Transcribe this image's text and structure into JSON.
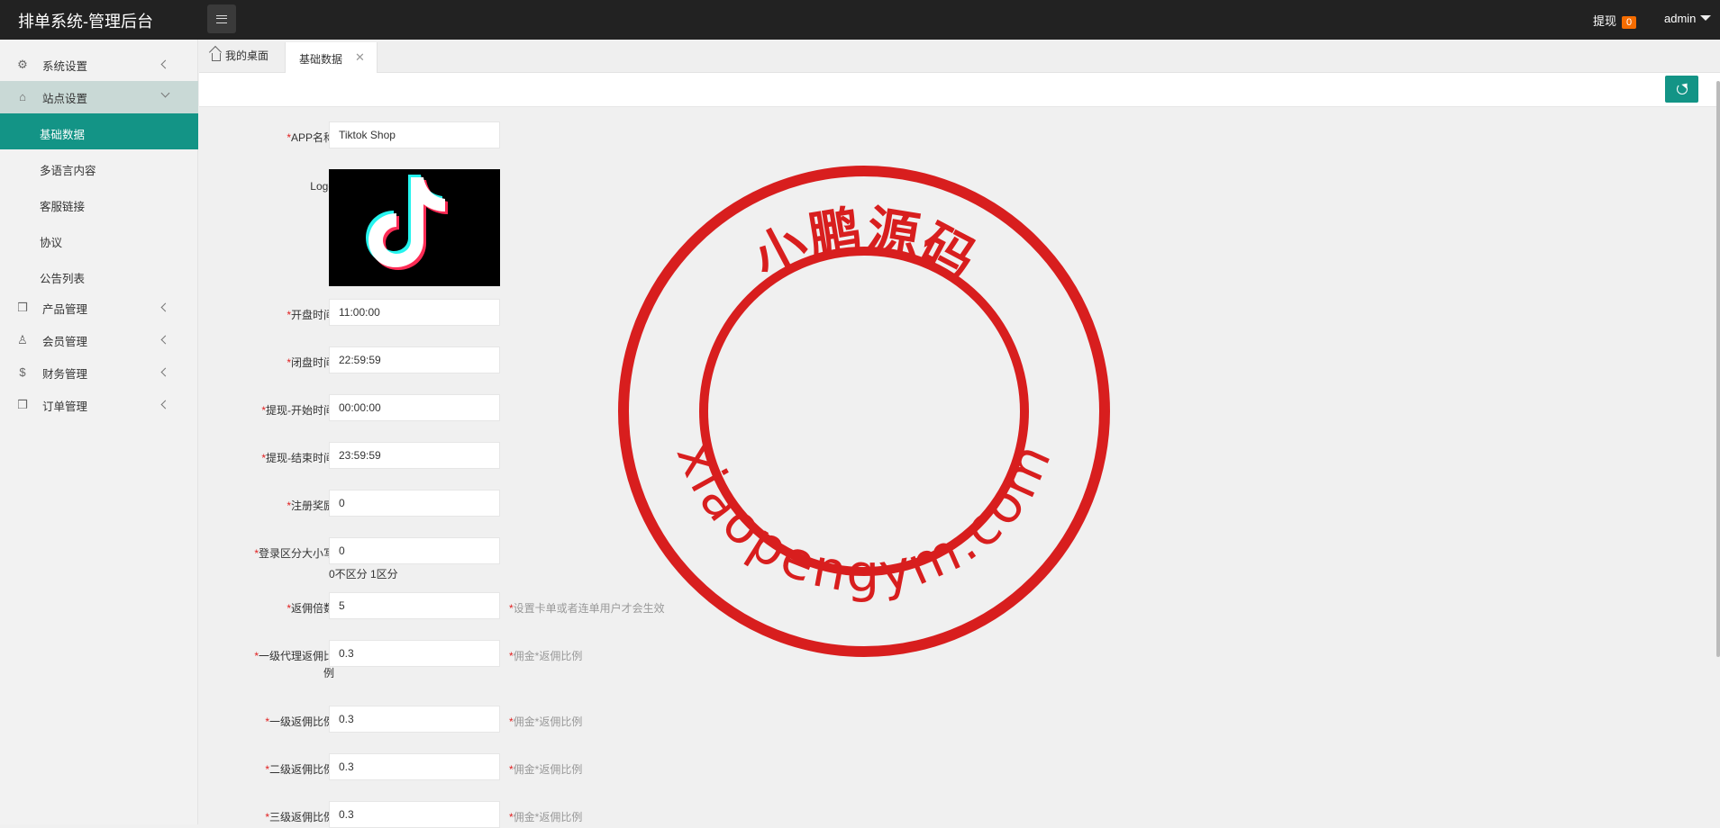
{
  "header": {
    "brand": "排单系统-管理后台",
    "withdraw_label": "提现",
    "withdraw_count": "0",
    "user": "admin"
  },
  "sidebar": {
    "items": [
      {
        "label": "系统设置",
        "icon": "gear-icon"
      },
      {
        "label": "站点设置",
        "icon": "site-icon"
      },
      {
        "label": "产品管理",
        "icon": "cube-icon"
      },
      {
        "label": "会员管理",
        "icon": "user-icon"
      },
      {
        "label": "财务管理",
        "icon": "dollar-icon"
      },
      {
        "label": "订单管理",
        "icon": "box-icon"
      }
    ],
    "sub_items": [
      {
        "label": "基础数据"
      },
      {
        "label": "多语言内容"
      },
      {
        "label": "客服链接"
      },
      {
        "label": "协议"
      },
      {
        "label": "公告列表"
      }
    ]
  },
  "tabs": {
    "home": "我的桌面",
    "active": "基础数据"
  },
  "form": {
    "app_name": {
      "label": "APP名称",
      "value": "Tiktok Shop"
    },
    "logo": {
      "label": "Logo"
    },
    "open_time": {
      "label": "开盘时间",
      "value": "11:00:00"
    },
    "close_time": {
      "label": "闭盘时间",
      "value": "22:59:59"
    },
    "withdraw_start": {
      "label": "提现-开始时间",
      "value": "00:00:00"
    },
    "withdraw_end": {
      "label": "提现-结束时间",
      "value": "23:59:59"
    },
    "register_bonus": {
      "label": "注册奖励",
      "value": "0"
    },
    "login_case": {
      "label": "登录区分大小写",
      "value": "0",
      "note": "0不区分 1区分"
    },
    "rebate_multiple": {
      "label": "返佣倍数",
      "value": "5",
      "hint": "设置卡单或者连单用户才会生效"
    },
    "agent_level1": {
      "label": "一级代理返佣比例",
      "value": "0.3",
      "hint": "佣金*返佣比例"
    },
    "level1": {
      "label": "一级返佣比例",
      "value": "0.3",
      "hint": "佣金*返佣比例"
    },
    "level2": {
      "label": "二级返佣比例",
      "value": "0.3",
      "hint": "佣金*返佣比例"
    },
    "level3": {
      "label": "三级返佣比例",
      "value": "0.3",
      "hint": "佣金*返佣比例"
    }
  },
  "watermark": {
    "title": "小鹏源码",
    "url": "xiaopengym.com"
  },
  "colors": {
    "accent": "#139486",
    "header_bg": "#222222",
    "badge": "#f56c00",
    "stamp": "#d81e1e"
  }
}
